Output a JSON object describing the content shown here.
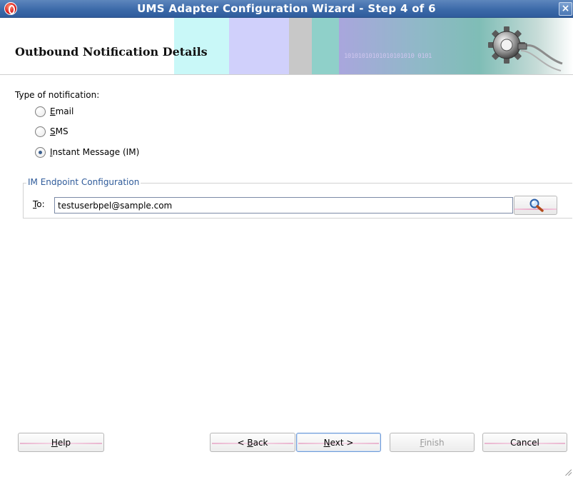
{
  "window": {
    "title": "UMS Adapter Configuration Wizard - Step 4 of 6",
    "close_symbol": "×"
  },
  "header": {
    "title": "Outbound Notification Details",
    "banner_binary_text": "10101010101010101010  0101",
    "banner_icon": "gear-plug-icon"
  },
  "notification_type": {
    "label": "Type of notification:",
    "options": [
      {
        "mnemonic": "E",
        "rest": "mail",
        "selected": false
      },
      {
        "mnemonic": "S",
        "rest": "MS",
        "selected": false
      },
      {
        "mnemonic": "I",
        "rest": "nstant Message (IM)",
        "selected": true
      }
    ]
  },
  "endpoint": {
    "group_label": "IM Endpoint Configuration",
    "to_mnemonic": "T",
    "to_rest": "o:",
    "to_value": "testuserbpel@sample.com",
    "search_icon": "search-icon"
  },
  "buttons": {
    "help": {
      "mnemonic": "H",
      "rest": "elp"
    },
    "back": {
      "prefix": "< ",
      "mnemonic": "B",
      "rest": "ack"
    },
    "next": {
      "mnemonic": "N",
      "rest": "ext >"
    },
    "finish": {
      "mnemonic": "F",
      "rest": "inish"
    },
    "cancel": {
      "label": "Cancel"
    }
  },
  "colors": {
    "titlebar": "#3c6aa9",
    "group_label": "#2f5b9a",
    "default_button_border": "#6f9bd8"
  }
}
